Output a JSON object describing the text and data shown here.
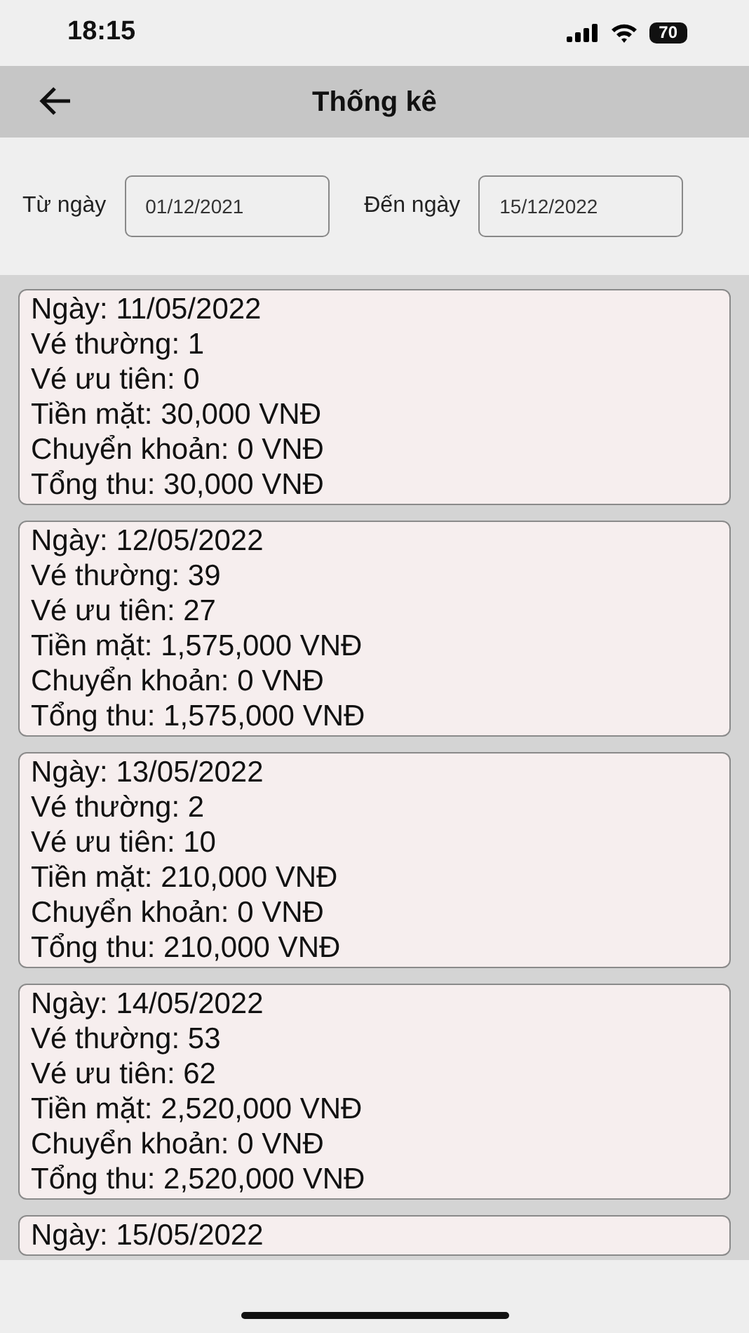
{
  "status_bar": {
    "time": "18:15",
    "battery": "70"
  },
  "header": {
    "title": "Thống kê"
  },
  "filter": {
    "from_label": "Từ ngày",
    "from_value": "01/12/2021",
    "to_label": "Đến ngày",
    "to_value": "15/12/2022"
  },
  "records": [
    {
      "lines": [
        "Ngày: 11/05/2022",
        "Vé thường: 1",
        "Vé ưu tiên: 0",
        "Tiền mặt: 30,000 VNĐ",
        "Chuyển khoản: 0 VNĐ",
        "Tổng thu: 30,000 VNĐ"
      ]
    },
    {
      "lines": [
        "Ngày: 12/05/2022",
        "Vé thường: 39",
        "Vé ưu tiên: 27",
        "Tiền mặt: 1,575,000 VNĐ",
        "Chuyển khoản: 0 VNĐ",
        "Tổng thu: 1,575,000 VNĐ"
      ]
    },
    {
      "lines": [
        "Ngày: 13/05/2022",
        "Vé thường: 2",
        "Vé ưu tiên: 10",
        "Tiền mặt: 210,000 VNĐ",
        "Chuyển khoản: 0 VNĐ",
        "Tổng thu: 210,000 VNĐ"
      ]
    },
    {
      "lines": [
        "Ngày: 14/05/2022",
        "Vé thường: 53",
        "Vé ưu tiên: 62",
        "Tiền mặt: 2,520,000 VNĐ",
        "Chuyển khoản: 0 VNĐ",
        "Tổng thu: 2,520,000 VNĐ"
      ]
    },
    {
      "lines": [
        "Ngày: 15/05/2022"
      ]
    }
  ]
}
